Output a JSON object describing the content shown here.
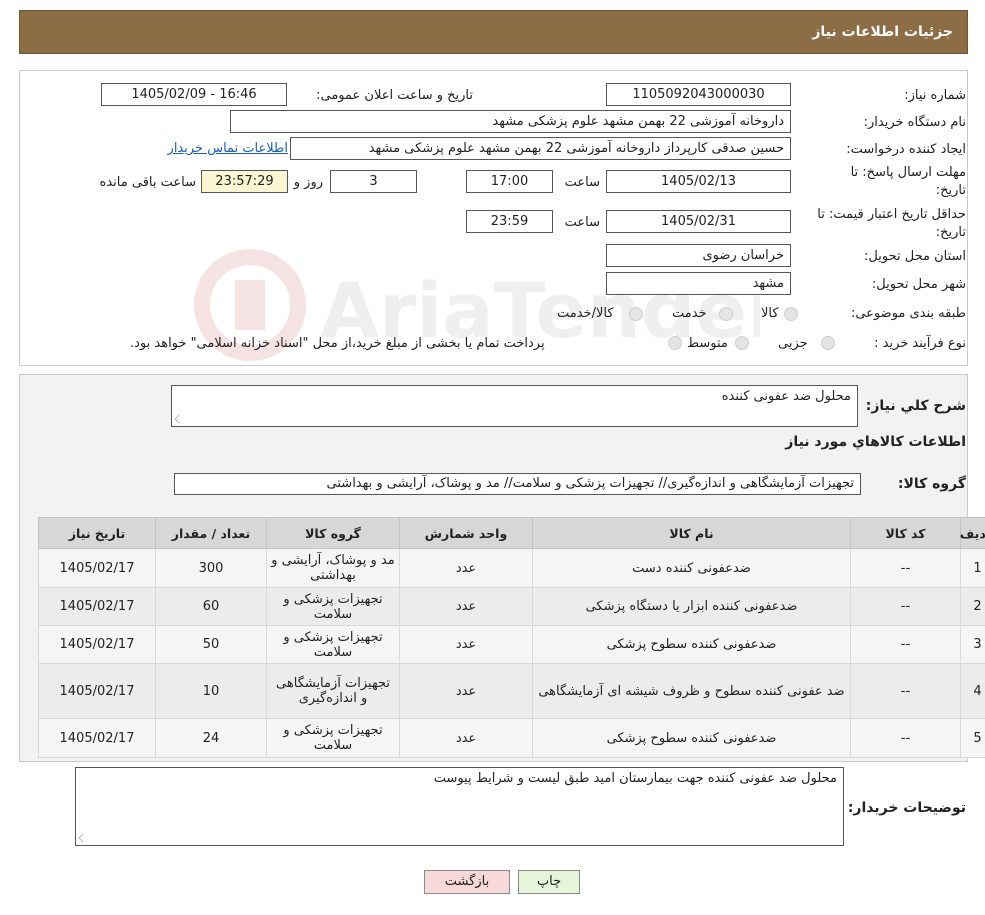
{
  "header": {
    "title": "جزئیات اطلاعات نیاز"
  },
  "fields": {
    "need_number_label": "شماره نیاز:",
    "need_number": "1105092043000030",
    "announce_label": "تاریخ و ساعت اعلان عمومی:",
    "announce_value": "1405/02/09 - 16:46",
    "buyer_org_label": "نام دستگاه خریدار:",
    "buyer_org": "داروخانه آموزشی 22 بهمن مشهد   علوم پزشکی مشهد",
    "creator_label": "ایجاد کننده درخواست:",
    "creator": "حسین صدقی کارپرداز داروخانه آموزشی 22 بهمن مشهد   علوم پزشکی مشهد",
    "contact_link": "اطلاعات تماس خریدار",
    "reply_deadline_label_1": "مهلت ارسال پاسخ: تا",
    "reply_deadline_label_2": "تاریخ:",
    "reply_date": "1405/02/13",
    "time_label": "ساعت",
    "reply_time": "17:00",
    "days_value": "3",
    "days_label": "روز و",
    "remaining_time": "23:57:29",
    "remaining_label": "ساعت باقی مانده",
    "validity_label_1": "حداقل تاریخ اعتبار قیمت: تا",
    "validity_label_2": "تاریخ:",
    "validity_date": "1405/02/31",
    "validity_time_label": "ساعت",
    "validity_time": "23:59",
    "province_label": "استان محل تحویل:",
    "province": "خراسان رضوی",
    "city_label": "شهر محل تحویل:",
    "city": "مشهد",
    "category_label": "طبقه بندی موضوعی:",
    "category_options": [
      "کالا",
      "خدمت",
      "کالا/خدمت"
    ],
    "process_label": "نوع فرآیند خرید :",
    "process_options": [
      "جزیی",
      "متوسط"
    ],
    "process_note": "پرداخت تمام یا بخشی از مبلغ خرید،از محل \"اسناد خزانه اسلامی\" خواهد بود."
  },
  "description": {
    "label": "شرح کلي نياز:",
    "value": "محلول ضد عفونی کننده"
  },
  "goods_section": {
    "title": "اطلاعات کالاهاي مورد نياز",
    "group_label": "گروه کالا:",
    "group_value": "تجهیزات آزمایشگاهی و اندازه‌گیری// تجهیزات پزشکی و سلامت// مد و پوشاک، آرایشی و بهداشتی"
  },
  "table": {
    "headers": [
      "ردیف",
      "کد کالا",
      "نام کالا",
      "واحد شمارش",
      "گروه کالا",
      "تعداد / مقدار",
      "تاریخ نیاز"
    ],
    "rows": [
      {
        "row": "1",
        "code": "--",
        "name": "ضدعفونی کننده دست",
        "unit": "عدد",
        "group": "مد و پوشاک، آرایشی و بهداشتی",
        "qty": "300",
        "date": "1405/02/17"
      },
      {
        "row": "2",
        "code": "--",
        "name": "ضدعفونی کننده ابزار یا دستگاه پزشکی",
        "unit": "عدد",
        "group": "تجهیزات پزشکی و سلامت",
        "qty": "60",
        "date": "1405/02/17"
      },
      {
        "row": "3",
        "code": "--",
        "name": "ضدعفونی کننده سطوح پزشکی",
        "unit": "عدد",
        "group": "تجهیزات پزشکی و سلامت",
        "qty": "50",
        "date": "1405/02/17"
      },
      {
        "row": "4",
        "code": "--",
        "name": "ضد عفونی کننده سطوح و ظروف شیشه ای آزمایشگاهی",
        "unit": "عدد",
        "group": "تجهیزات آزمایشگاهی و اندازه‌گیری",
        "qty": "10",
        "date": "1405/02/17"
      },
      {
        "row": "5",
        "code": "--",
        "name": "ضدعفونی کننده سطوح پزشکی",
        "unit": "عدد",
        "group": "تجهیزات پزشکی و سلامت",
        "qty": "24",
        "date": "1405/02/17"
      }
    ]
  },
  "buyer_notes": {
    "label": "توضیحات خریدار:",
    "value": "محلول ضد عفونی کننده جهت بیمارستان امید طبق لیست و شرایط پیوست"
  },
  "buttons": {
    "print": "چاپ",
    "back": "بازگشت"
  },
  "watermark": {
    "text": "AriaTender.neT"
  },
  "colors": {
    "header_bg": "#8c6d45",
    "link": "#1a5fb4",
    "back_button_bg": "#f7d9d9",
    "print_button_bg": "#e6f4d9"
  }
}
